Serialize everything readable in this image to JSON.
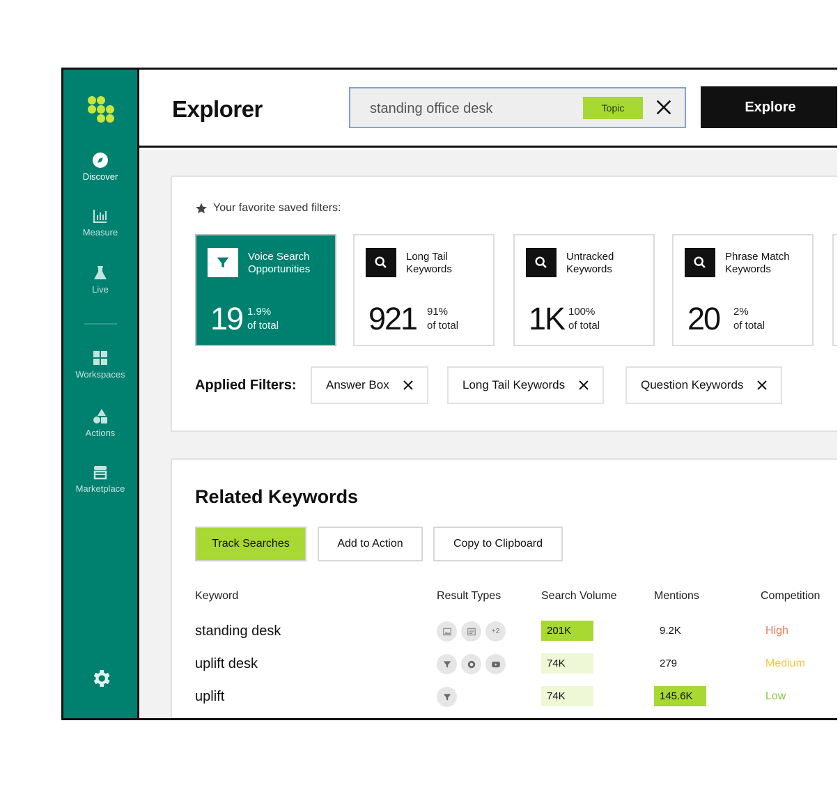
{
  "sidebar": {
    "items": [
      {
        "label": "Discover",
        "icon": "compass-icon"
      },
      {
        "label": "Measure",
        "icon": "bar-chart-icon"
      },
      {
        "label": "Live",
        "icon": "flask-icon"
      },
      {
        "label": "Workspaces",
        "icon": "grid-icon"
      },
      {
        "label": "Actions",
        "icon": "shapes-icon"
      },
      {
        "label": "Marketplace",
        "icon": "storefront-icon"
      }
    ],
    "settings_icon": "gear-icon"
  },
  "header": {
    "title": "Explorer",
    "search_value": "standing office desk",
    "search_tag": "Topic",
    "explore_label": "Explore"
  },
  "favorites": {
    "label": "Your favorite saved filters:",
    "filters": [
      {
        "name": "Voice Search Opportunities",
        "count": "19",
        "percent": "1.9%",
        "of_total": "of total",
        "icon": "filter-icon"
      },
      {
        "name": "Long Tail Keywords",
        "count": "921",
        "percent": "91%",
        "of_total": "of total",
        "icon": "search-icon"
      },
      {
        "name": "Untracked Keywords",
        "count": "1K",
        "percent": "100%",
        "of_total": "of total",
        "icon": "search-icon"
      },
      {
        "name": "Phrase Match Keywords",
        "count": "20",
        "percent": "2%",
        "of_total": "of total",
        "icon": "search-icon"
      }
    ]
  },
  "applied": {
    "label": "Applied Filters:",
    "chips": [
      "Answer Box",
      "Long Tail Keywords",
      "Question Keywords"
    ]
  },
  "related": {
    "title": "Related Keywords",
    "actions": [
      "Track Searches",
      "Add to Action",
      "Copy to Clipboard"
    ],
    "columns": [
      "Keyword",
      "Result Types",
      "Search Volume",
      "Mentions",
      "Competition"
    ],
    "rows": [
      {
        "keyword": "standing desk",
        "result_types": [
          "image-icon",
          "news-icon"
        ],
        "more": "+2",
        "volume": "201K",
        "mentions": "9.2K",
        "competition": "High"
      },
      {
        "keyword": "uplift desk",
        "result_types": [
          "filter-icon",
          "circle-play-icon",
          "video-icon"
        ],
        "more": "",
        "volume": "74K",
        "mentions": "279",
        "competition": "Medium"
      },
      {
        "keyword": "uplift",
        "result_types": [
          "filter-icon"
        ],
        "more": "",
        "volume": "74K",
        "mentions": "145.6K",
        "competition": "Low"
      }
    ]
  },
  "colors": {
    "brand_teal": "#00806f",
    "accent_lime": "#a8d832",
    "high": "#f07a5a",
    "medium": "#f5c542",
    "low": "#8cc63f"
  }
}
